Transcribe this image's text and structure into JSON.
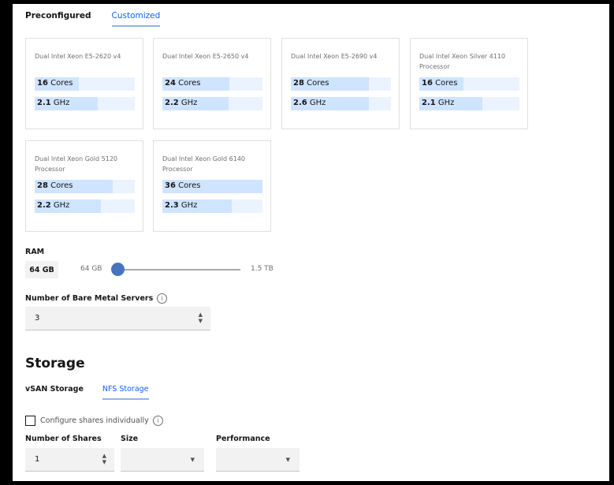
{
  "tabs": [
    {
      "label": "Preconfigured",
      "active": false
    },
    {
      "label": "Customized",
      "active": true
    }
  ],
  "processors": [
    {
      "name": "Dual Intel Xeon E5-2620 v4",
      "cores_value": "16",
      "cores_unit": "Cores",
      "cores": 16,
      "ghz_value": "2.1",
      "ghz_unit": "GHz",
      "ghz": 2.1
    },
    {
      "name": "Dual Intel Xeon E5-2650 v4",
      "cores_value": "24",
      "cores_unit": "Cores",
      "cores": 24,
      "ghz_value": "2.2",
      "ghz_unit": "GHz",
      "ghz": 2.2
    },
    {
      "name": "Dual Intel Xeon E5-2690 v4",
      "cores_value": "28",
      "cores_unit": "Cores",
      "cores": 28,
      "ghz_value": "2.6",
      "ghz_unit": "GHz",
      "ghz": 2.6
    },
    {
      "name": "Dual Intel Xeon Silver 4110 Processor",
      "cores_value": "16",
      "cores_unit": "Cores",
      "cores": 16,
      "ghz_value": "2.1",
      "ghz_unit": "GHz",
      "ghz": 2.1
    },
    {
      "name": "Dual Intel Xeon Gold 5120 Processor",
      "cores_value": "28",
      "cores_unit": "Cores",
      "cores": 28,
      "ghz_value": "2.2",
      "ghz_unit": "GHz",
      "ghz": 2.2
    },
    {
      "name": "Dual Intel Xeon Gold 6140 Processor",
      "cores_value": "36",
      "cores_unit": "Cores",
      "cores": 36,
      "ghz_value": "2.3",
      "ghz_unit": "GHz",
      "ghz": 2.3
    }
  ],
  "ram": {
    "label": "RAM",
    "value": "64 GB",
    "min_label": "64 GB",
    "max_label": "1.5 TB",
    "fraction": 0.0
  },
  "servers": {
    "label": "Number of Bare Metal Servers",
    "value": "3",
    "info_icon": "info-icon"
  },
  "storage": {
    "heading": "Storage",
    "tabs": [
      {
        "label": "vSAN Storage",
        "active": false
      },
      {
        "label": "NFS Storage",
        "active": true
      }
    ],
    "configure_label": "Configure shares individually",
    "configure_checked": false,
    "shares_label": "Number of Shares",
    "shares_value": "1",
    "size_label": "Size",
    "size_value": "",
    "performance_label": "Performance",
    "performance_value": ""
  },
  "colors": {
    "accent": "#0f62fe",
    "slider": "#4674c1",
    "bar_bg": "#eaf3ff",
    "bar_fill": "#cfe4ff"
  }
}
